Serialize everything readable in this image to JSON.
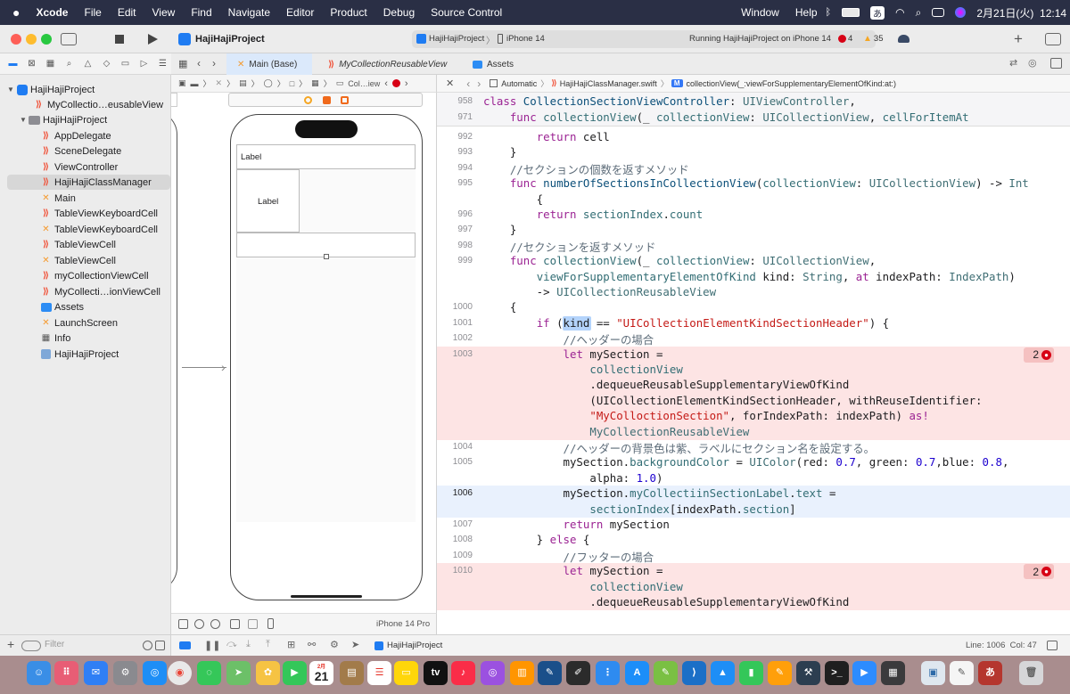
{
  "menubar": {
    "app_name": "Xcode",
    "menus": [
      "File",
      "Edit",
      "View",
      "Find",
      "Navigate",
      "Editor",
      "Product",
      "Debug",
      "Source Control",
      "Window",
      "Help"
    ],
    "input_mode": "あ",
    "date_time": "2月21日(火)  12:14"
  },
  "toolbar": {
    "project_name": "HajiHajiProject",
    "scheme_target": "HajiHajiProject",
    "device": "iPhone 14",
    "status": "Running HajiHajiProject on iPhone 14",
    "error_count": "4",
    "warning_count": "35"
  },
  "navigator": {
    "items": [
      {
        "label": "HajiHajiProject",
        "icon": "app-project-icon",
        "kind": "project"
      },
      {
        "label": "MyCollectio…eusableView",
        "icon": "swift-file-icon",
        "kind": "swift"
      },
      {
        "label": "HajiHajiProject",
        "icon": "folder-icon",
        "kind": "folder"
      },
      {
        "label": "AppDelegate",
        "icon": "swift-file-icon",
        "kind": "swift"
      },
      {
        "label": "SceneDelegate",
        "icon": "swift-file-icon",
        "kind": "swift"
      },
      {
        "label": "ViewController",
        "icon": "swift-file-icon",
        "kind": "swift"
      },
      {
        "label": "HajiHajiClassManager",
        "icon": "swift-file-icon",
        "kind": "swift",
        "selected": true
      },
      {
        "label": "Main",
        "icon": "storyboard-icon",
        "kind": "xib"
      },
      {
        "label": "TableViewKeyboardCell",
        "icon": "swift-file-icon",
        "kind": "swift"
      },
      {
        "label": "TableViewKeyboardCell",
        "icon": "xib-icon",
        "kind": "xib"
      },
      {
        "label": "TableViewCell",
        "icon": "swift-file-icon",
        "kind": "swift"
      },
      {
        "label": "TableViewCell",
        "icon": "xib-icon",
        "kind": "xib"
      },
      {
        "label": "myCollectionViewCell",
        "icon": "swift-file-icon",
        "kind": "swift"
      },
      {
        "label": "MyCollecti…ionViewCell",
        "icon": "swift-file-icon",
        "kind": "swift"
      },
      {
        "label": "Assets",
        "icon": "asset-catalog-icon",
        "kind": "assets"
      },
      {
        "label": "LaunchScreen",
        "icon": "xib-icon",
        "kind": "xib"
      },
      {
        "label": "Info",
        "icon": "plist-icon",
        "kind": "plist"
      },
      {
        "label": "HajiHajiProject",
        "icon": "entitlements-icon",
        "kind": "ent"
      }
    ],
    "filter_placeholder": "Filter"
  },
  "tabs": [
    {
      "label": "Main (Base)",
      "icon": "storyboard-icon",
      "active": true
    },
    {
      "label": "MyCollectionReusableView",
      "icon": "swift-file-icon",
      "active": false
    },
    {
      "label": "Assets",
      "icon": "asset-catalog-icon",
      "active": false
    }
  ],
  "ib_jump": {
    "crumb": "Col…iew"
  },
  "canvas": {
    "label_top": "Label",
    "label_cell": "Label"
  },
  "ib_bottom": {
    "device": "iPhone 14 Pro"
  },
  "code_jump": {
    "mode": "Automatic",
    "file": "HajiHajiClassManager.swift",
    "method_badge": "M",
    "symbol": "collectionView(_:viewForSupplementaryElementOfKind:at:)"
  },
  "code": {
    "sticky": [
      {
        "num": "958",
        "text": "class CollectionSectionViewController: UIViewController,"
      },
      {
        "num": "971",
        "text": "    func collectionView(_ collectionView: UICollectionView, cellForItemAt"
      }
    ],
    "lines": [
      {
        "num": "992",
        "text": "        return cell"
      },
      {
        "num": "993",
        "text": "    }"
      },
      {
        "num": "994",
        "text": "    //セクションの個数を返すメソッド"
      },
      {
        "num": "995",
        "text": "    func numberOfSectionsInCollectionView(collectionView: UICollectionView) -> Int"
      },
      {
        "num": "",
        "text": "        {"
      },
      {
        "num": "996",
        "text": "        return sectionIndex.count"
      },
      {
        "num": "997",
        "text": "    }"
      },
      {
        "num": "998",
        "text": "    //セクションを返すメソッド"
      },
      {
        "num": "999",
        "text": "    func collectionView(_ collectionView: UICollectionView,"
      },
      {
        "num": "",
        "text": "        viewForSupplementaryElementOfKind kind: String, at indexPath: IndexPath)"
      },
      {
        "num": "",
        "text": "        -> UICollectionReusableView"
      },
      {
        "num": "1000",
        "text": "    {"
      },
      {
        "num": "1001",
        "text": "        if (kind == \"UICollectionElementKindSectionHeader\") {"
      },
      {
        "num": "1002",
        "text": "            //ヘッダーの場合"
      },
      {
        "num": "1003",
        "text": "            let mySection ="
      },
      {
        "num": "",
        "text": "                collectionView"
      },
      {
        "num": "",
        "text": "                .dequeueReusableSupplementaryViewOfKind"
      },
      {
        "num": "",
        "text": "                (UICollectionElementKindSectionHeader, withReuseIdentifier:"
      },
      {
        "num": "",
        "text": "                \"MyColloctionSection\", forIndexPath: indexPath) as!"
      },
      {
        "num": "",
        "text": "                MyCollectionReusableView"
      },
      {
        "num": "1004",
        "text": "            //ヘッダーの背景色は紫、ラベルにセクション名を設定する。"
      },
      {
        "num": "1005",
        "text": "            mySection.backgroundColor = UIColor(red: 0.7, green: 0.7,blue: 0.8,"
      },
      {
        "num": "",
        "text": "                alpha: 1.0)"
      },
      {
        "num": "1006",
        "text": "            mySection.myCollectiinSectionLabel.text ="
      },
      {
        "num": "",
        "text": "                sectionIndex[indexPath.section]"
      },
      {
        "num": "1007",
        "text": "            return mySection"
      },
      {
        "num": "1008",
        "text": "        } else {"
      },
      {
        "num": "1009",
        "text": "            //フッターの場合"
      },
      {
        "num": "1010",
        "text": "            let mySection ="
      },
      {
        "num": "",
        "text": "                collectionView"
      },
      {
        "num": "",
        "text": "                .dequeueReusableSupplementaryViewOfKind"
      }
    ],
    "error_badges": [
      {
        "line": "1003",
        "count": "2"
      },
      {
        "line": "1010",
        "count": "2"
      }
    ]
  },
  "debugbar": {
    "target": "HajiHajiProject",
    "position": "Line: 1006  Col: 47"
  },
  "dock": {
    "calendar_month": "2月",
    "calendar_day": "21",
    "apps": [
      "finder-icon",
      "launchpad-icon",
      "mail-icon",
      "system-settings-icon",
      "safari-icon",
      "chrome-icon",
      "messages-icon",
      "maps-icon",
      "photos-icon",
      "facetime-icon",
      "calendar-icon",
      "notebook-icon",
      "reminders-icon",
      "notes-icon",
      "apple-tv-icon",
      "music-icon",
      "podcasts-icon",
      "books-icon",
      "pen-icon",
      "pencil-icon",
      "files-icon",
      "app-store-icon",
      "editor-icon",
      "vscode-icon",
      "keynote-icon",
      "numbers-icon",
      "pages-icon",
      "xcode-icon",
      "terminal-icon",
      "zoom-icon",
      "calculator-icon",
      "preview-icon",
      "textedit-icon",
      "dictionary-icon",
      "trash-icon"
    ]
  }
}
